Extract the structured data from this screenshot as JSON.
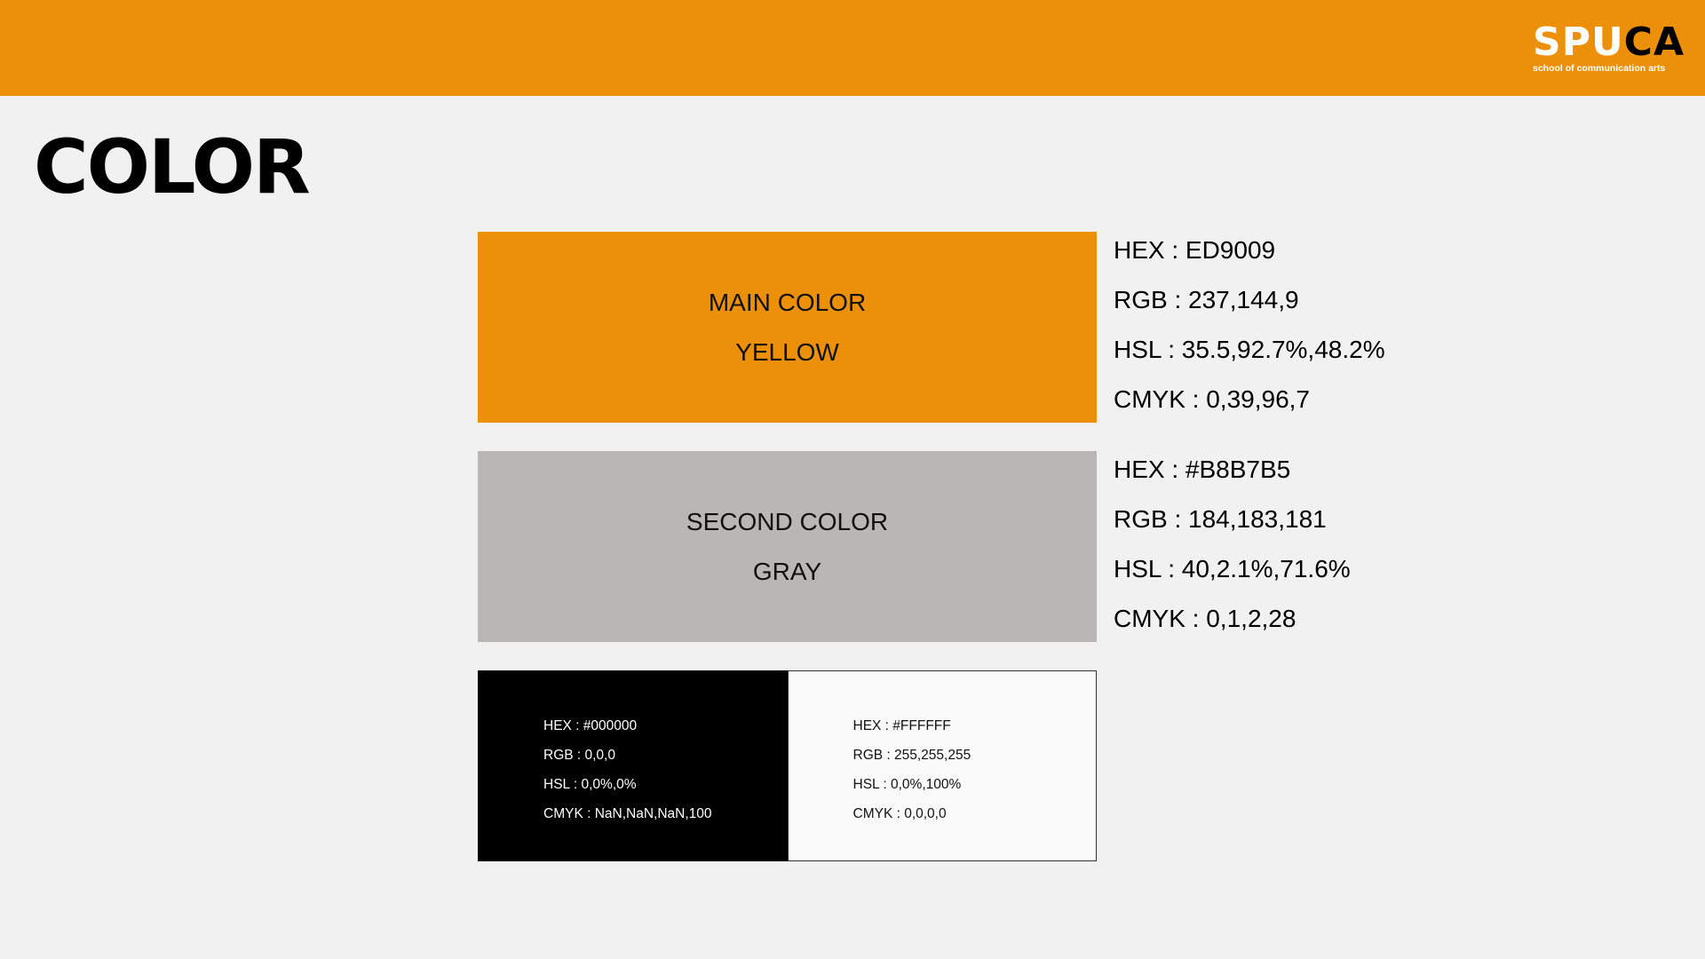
{
  "header": {
    "brand_color": "#ED9009",
    "logo": {
      "word_part1": "SPU",
      "word_part2": "CA",
      "tagline": "school of communication arts"
    }
  },
  "title": "COLOR",
  "main_color": {
    "swatch_hex": "#ED9009",
    "label": "MAIN COLOR",
    "name": "YELLOW",
    "hex": "HEX : ED9009",
    "rgb": "RGB : 237,144,9",
    "hsl": "HSL : 35.5,92.7%,48.2%",
    "cmyk": "CMYK : 0,39,96,7"
  },
  "second_color": {
    "swatch_hex": "#B8B7B5",
    "label": "SECOND COLOR",
    "name": "GRAY",
    "hex": "HEX : #B8B7B5",
    "rgb": "RGB : 184,183,181",
    "hsl": "HSL : 40,2.1%,71.6%",
    "cmyk": "CMYK : 0,1,2,28"
  },
  "black": {
    "swatch_hex": "#000000",
    "hex": "HEX : #000000",
    "rgb": "RGB : 0,0,0",
    "hsl": "HSL : 0,0%,0%",
    "cmyk": "CMYK : NaN,NaN,NaN,100"
  },
  "white": {
    "swatch_hex": "#FFFFFF",
    "hex": "HEX : #FFFFFF",
    "rgb": "RGB : 255,255,255",
    "hsl": "HSL : 0,0%,100%",
    "cmyk": "CMYK : 0,0,0,0"
  }
}
